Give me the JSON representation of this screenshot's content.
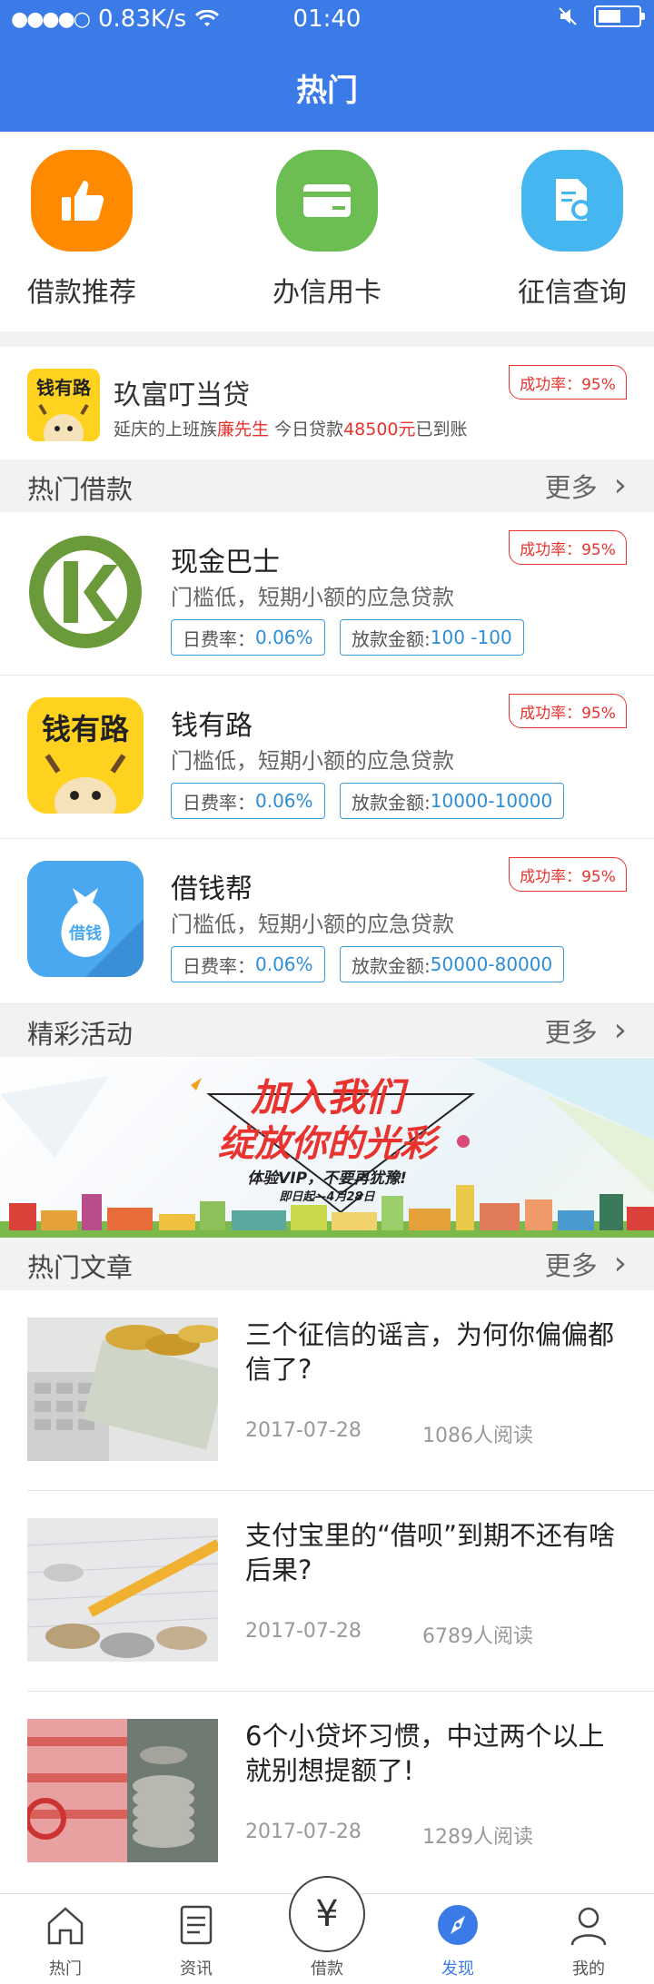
{
  "status_bar": {
    "network_speed": "0.83K/s",
    "time": "01:40"
  },
  "header": {
    "title": "热门"
  },
  "quick_entries": [
    {
      "label": "借款推荐",
      "icon": "thumbs-up-icon",
      "color": "#ff8a00"
    },
    {
      "label": "办信用卡",
      "icon": "credit-card-icon",
      "color": "#6cbd52"
    },
    {
      "label": "征信查询",
      "icon": "document-search-icon",
      "color": "#45b6f0"
    }
  ],
  "notice": {
    "logo_text": "钱有路",
    "title": "玖富叮当贷",
    "sub_prefix": "延庆的上班族",
    "sub_name": "廉先生",
    "sub_middle": "  今日贷款",
    "sub_amount": "48500元",
    "sub_suffix": "已到账",
    "success_rate": "成功率：95%"
  },
  "hot_loans": {
    "title": "热门借款",
    "more": "更多",
    "items": [
      {
        "name": "现金巴士",
        "desc": "门槛低，短期小额的应急贷款",
        "rate_label": "日费率：",
        "rate_value": "0.06%",
        "amount_label": "放款金额:",
        "amount_value": "100 -100",
        "success_rate": "成功率：95%"
      },
      {
        "name": "钱有路",
        "desc": "门槛低，短期小额的应急贷款",
        "rate_label": "日费率：",
        "rate_value": "0.06%",
        "amount_label": "放款金额:",
        "amount_value": "10000-10000",
        "success_rate": "成功率：95%",
        "logo_text": "钱有路"
      },
      {
        "name": "借钱帮",
        "desc": "门槛低，短期小额的应急贷款",
        "rate_label": "日费率：",
        "rate_value": "0.06%",
        "amount_label": "放款金额:",
        "amount_value": "50000-80000",
        "success_rate": "成功率：95%",
        "logo_text": "借钱"
      }
    ]
  },
  "activities": {
    "title": "精彩活动",
    "more": "更多",
    "banner": {
      "line1": "加入我们",
      "line2": "绽放你的光彩",
      "line3": "体验VIP，不要再犹豫!",
      "line4": "即日起—4月28日"
    }
  },
  "articles": {
    "title": "热门文章",
    "more": "更多",
    "items": [
      {
        "title": "三个征信的谣言，为何你偏偏都信了?",
        "date": "2017-07-28",
        "reads": "1086人阅读"
      },
      {
        "title": "支付宝里的“借呗”到期不还有啥后果?",
        "date": "2017-07-28",
        "reads": "6789人阅读"
      },
      {
        "title": "6个小贷坏习惯，中过两个以上就别想提额了!",
        "date": "2017-07-28",
        "reads": "1289人阅读"
      }
    ]
  },
  "tabbar": {
    "center_symbol": "¥",
    "items": [
      {
        "label": "热门",
        "icon": "home-icon"
      },
      {
        "label": "资讯",
        "icon": "news-icon"
      },
      {
        "label": "借款",
        "icon": "yen-icon"
      },
      {
        "label": "发现",
        "icon": "compass-icon",
        "active": true
      },
      {
        "label": "我的",
        "icon": "user-icon"
      }
    ],
    "active_color": "#3a7be8"
  }
}
